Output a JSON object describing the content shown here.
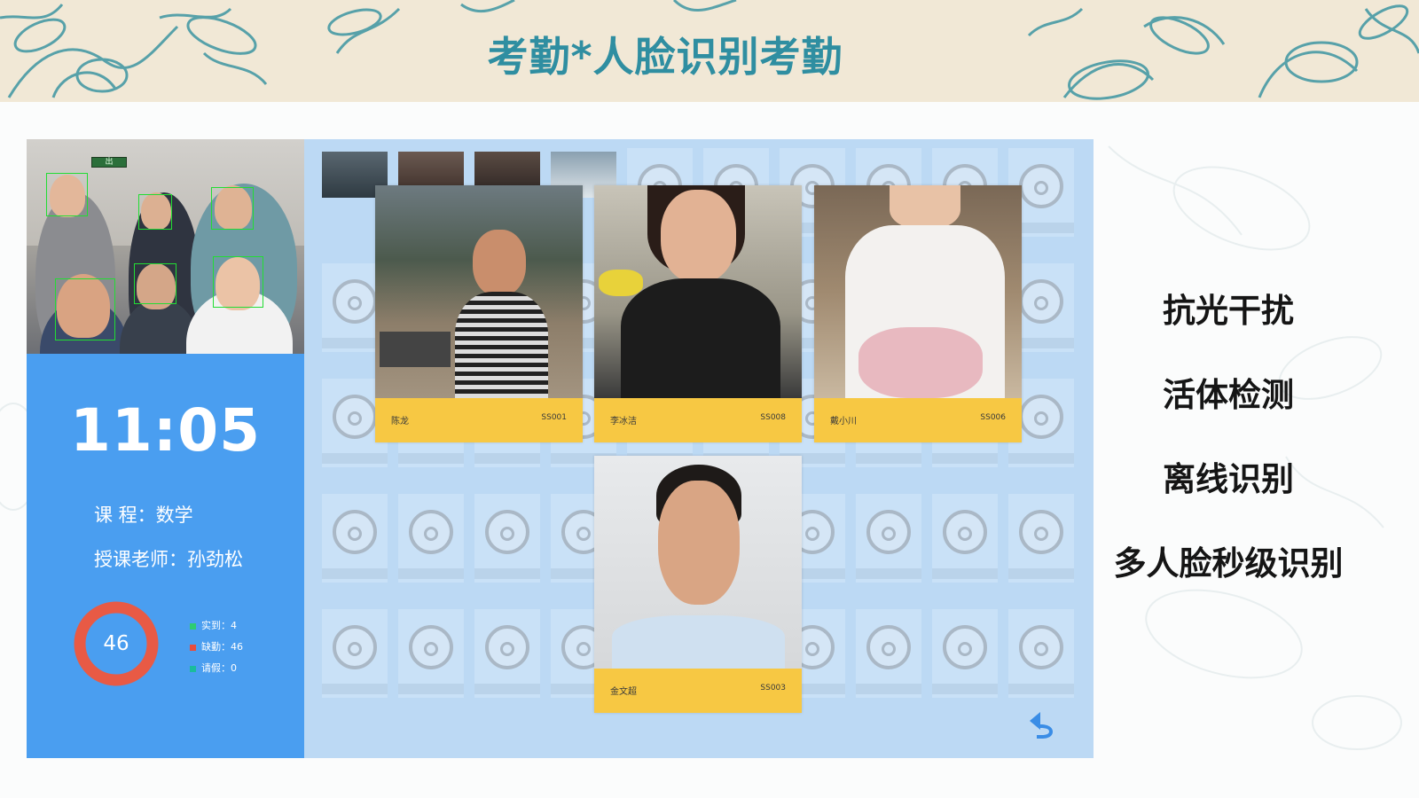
{
  "slide": {
    "title": "考勤*人脸识别考勤"
  },
  "camera": {
    "exit_sign": "出"
  },
  "left_panel": {
    "time": "11:05",
    "course_line": "课    程：数学",
    "teacher_line": "授课老师：孙劲松",
    "attendance_total": "46",
    "legend": [
      {
        "label": "实到：4",
        "color": "#2ecc71"
      },
      {
        "label": "缺勤：46",
        "color": "#e74c3c"
      },
      {
        "label": "请假：0",
        "color": "#1abc9c"
      }
    ],
    "donut_color": "#e85a45"
  },
  "cards": [
    {
      "name": "陈龙",
      "id": "SS001"
    },
    {
      "name": "李冰洁",
      "id": "SS008"
    },
    {
      "name": "戴小川",
      "id": "SS006"
    },
    {
      "name": "金文超",
      "id": "SS003"
    }
  ],
  "features": [
    "抗光干扰",
    "活体检测",
    "离线识别",
    "多人脸秒级识别"
  ],
  "colors": {
    "title": "#2f8ea1",
    "panel_blue": "#4a9ef0",
    "grid_bg": "#bcd9f4",
    "card_caption": "#f7c843"
  },
  "icons": {
    "back": "back-arrow-icon",
    "avatar": "avatar-placeholder-icon"
  }
}
